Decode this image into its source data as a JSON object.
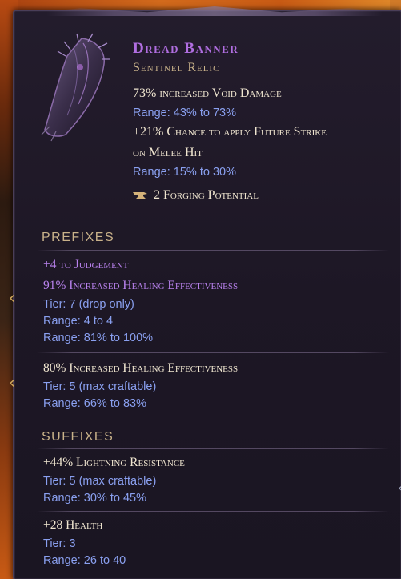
{
  "item": {
    "name": "Dread Banner",
    "type": "Sentinel Relic",
    "icon": "banner-relic-icon"
  },
  "implicits": [
    {
      "text": "73% increased Void Damage",
      "range": "Range: 43% to 73%"
    },
    {
      "text_line1": "+21% Chance to apply Future Strike",
      "text_line2": "on Melee Hit",
      "range": "Range: 15% to 30%"
    }
  ],
  "forging": {
    "text": "2 Forging Potential",
    "icon": "anvil-icon"
  },
  "prefixes": {
    "title": "PREFIXES",
    "affixes": [
      {
        "line1": "+4 to Judgement",
        "line2": "91% Increased Healing Effectiveness",
        "tier": "Tier: 7 (drop only)",
        "range1": "Range: 4 to 4",
        "range2": "Range: 81% to 100%"
      },
      {
        "line1": "80% Increased Healing Effectiveness",
        "tier": "Tier: 5 (max craftable)",
        "range1": "Range: 66% to 83%"
      }
    ]
  },
  "suffixes": {
    "title": "SUFFIXES",
    "affixes": [
      {
        "line1": "+44% Lightning Resistance",
        "tier": "Tier: 5 (max craftable)",
        "range1": "Range: 30% to 45%"
      },
      {
        "line1": "+28 Health",
        "tier": "Tier: 3",
        "range1": "Range: 26 to 40"
      }
    ]
  },
  "colors": {
    "legendary_purple": "#b06ee0",
    "affix_purple": "#b982ee",
    "range_blue": "#8aa0f0",
    "header_gold": "#c9b28a",
    "text_white": "#f0e6d0"
  }
}
